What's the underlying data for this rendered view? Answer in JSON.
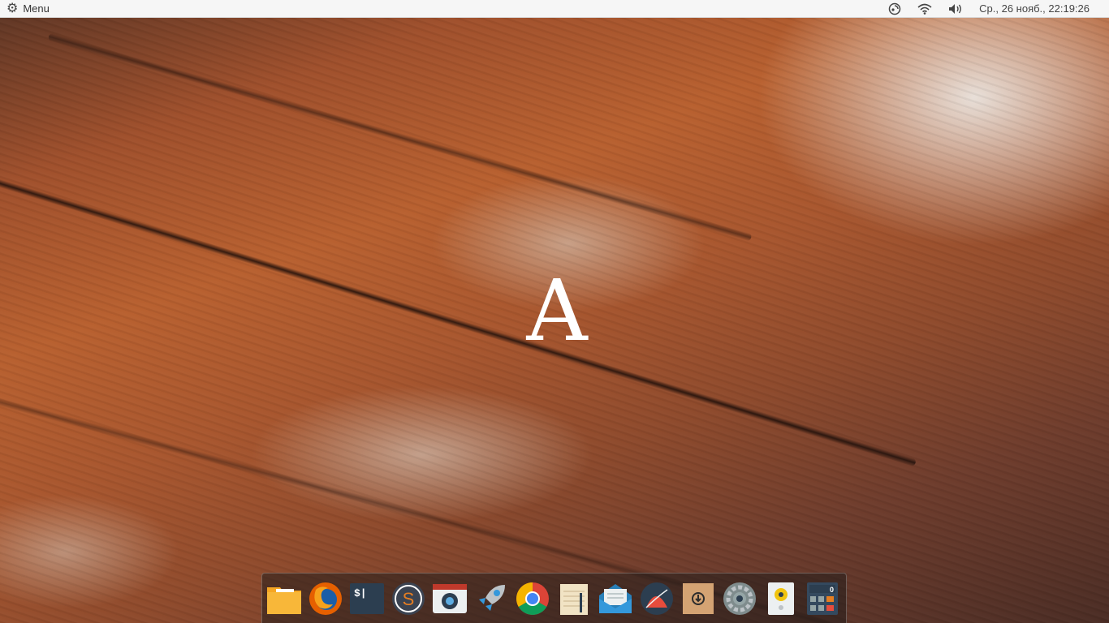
{
  "topbar": {
    "menu_icon": "gear-icon",
    "menu_label": "Menu",
    "tray_icons": [
      "update-notifier-icon",
      "wifi-icon",
      "volume-icon"
    ],
    "clock": "Ср., 26 нояб., 22:19:26"
  },
  "desktop": {
    "wallpaper": "blurred-wooden-planks",
    "logo_letter": "A"
  },
  "dock": {
    "apps": [
      {
        "icon": "files-icon",
        "color": "#f6a623"
      },
      {
        "icon": "firefox-icon",
        "color": "#e66000"
      },
      {
        "icon": "terminal-icon",
        "color": "#2c3e50",
        "glyph": "$|"
      },
      {
        "icon": "sublime-text-icon",
        "color": "#e67e22",
        "glyph": "S"
      },
      {
        "icon": "camera-icon",
        "color": "#ecf0f1"
      },
      {
        "icon": "rocket-launcher-icon",
        "color": "#3498db"
      },
      {
        "icon": "chrome-icon",
        "color": "#4285f4"
      },
      {
        "icon": "notes-icon",
        "color": "#f1e3c4"
      },
      {
        "icon": "mail-icon",
        "color": "#3498db"
      },
      {
        "icon": "gradient-app-icon",
        "color": "#e74c3c"
      },
      {
        "icon": "archive-manager-icon",
        "color": "#d4a373"
      },
      {
        "icon": "settings-icon",
        "color": "#7f8c8d"
      },
      {
        "icon": "speaker-icon",
        "color": "#f1c40f"
      },
      {
        "icon": "calculator-icon",
        "color": "#34495e",
        "glyph": "0"
      }
    ]
  }
}
